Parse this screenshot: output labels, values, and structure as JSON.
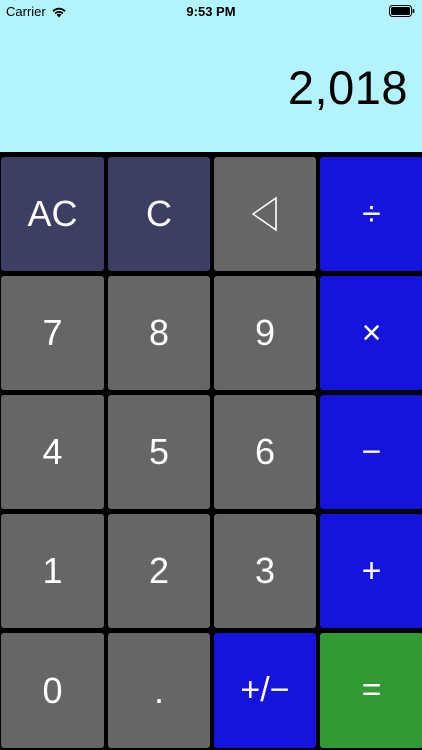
{
  "status_bar": {
    "carrier": "Carrier",
    "time": "9:53 PM"
  },
  "display": {
    "value": "2,018"
  },
  "keys": {
    "all_clear": "AC",
    "clear": "C",
    "backspace_icon": "backspace-triangle-icon",
    "divide": "÷",
    "seven": "7",
    "eight": "8",
    "nine": "9",
    "multiply": "×",
    "four": "4",
    "five": "5",
    "six": "6",
    "minus": "−",
    "one": "1",
    "two": "2",
    "three": "3",
    "plus": "+",
    "zero": "0",
    "decimal": ".",
    "negate": "+/−",
    "equals": "="
  },
  "colors": {
    "display_bg": "#b3f3fb",
    "function_key": "#3c3e62",
    "digit_key": "#666666",
    "operator_key": "#1414dc",
    "equals_key": "#339933"
  }
}
